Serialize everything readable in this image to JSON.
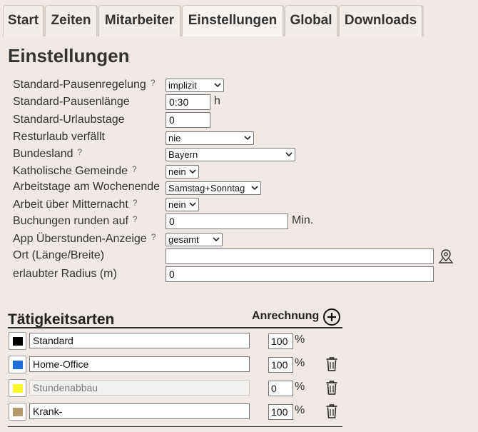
{
  "tabs": [
    {
      "label": "Start"
    },
    {
      "label": "Zeiten"
    },
    {
      "label": "Mitarbeiter"
    },
    {
      "label": "Einstellungen"
    },
    {
      "label": "Global"
    },
    {
      "label": "Downloads"
    }
  ],
  "active_tab": "Einstellungen",
  "page_title": "Einstellungen",
  "help_icon": "?",
  "settings": {
    "pause_rule": {
      "label": "Standard-Pausenregelung",
      "value": "implizit"
    },
    "pause_length": {
      "label": "Standard-Pausenlänge",
      "value": "0:30",
      "unit": "h"
    },
    "vacation_days": {
      "label": "Standard-Urlaubstage",
      "value": "0"
    },
    "vacation_expiry": {
      "label": "Resturlaub verfällt",
      "value": "nie"
    },
    "state": {
      "label": "Bundesland",
      "value": "Bayern"
    },
    "catholic": {
      "label": "Katholische Gemeinde",
      "value": "nein"
    },
    "weekend_days": {
      "label": "Arbeitstage am Wochenende",
      "value": "Samstag+Sonntag"
    },
    "midnight": {
      "label": "Arbeit über Mitternacht",
      "value": "nein"
    },
    "rounding": {
      "label": "Buchungen runden auf",
      "value": "0",
      "unit": "Min."
    },
    "overtime_display": {
      "label": "App Überstunden-Anzeige",
      "value": "gesamt"
    },
    "location": {
      "label": "Ort (Länge/Breite)",
      "value": ""
    },
    "radius": {
      "label": "erlaubter Radius (m)",
      "value": "0"
    }
  },
  "activities": {
    "title": "Tätigkeitsarten",
    "accounting_label": "Anrechnung",
    "percent_unit": "%",
    "items": [
      {
        "name": "Standard",
        "color": "#000000",
        "percent": "100",
        "deletable": false,
        "disabled": false
      },
      {
        "name": "Home-Office",
        "color": "#1e6fd9",
        "percent": "100",
        "deletable": true,
        "disabled": false
      },
      {
        "name": "Stundenabbau",
        "color": "#f8f82a",
        "percent": "0",
        "deletable": true,
        "disabled": true
      },
      {
        "name": "Krank-",
        "color": "#b5986a",
        "percent": "100",
        "deletable": true,
        "disabled": false
      }
    ]
  }
}
